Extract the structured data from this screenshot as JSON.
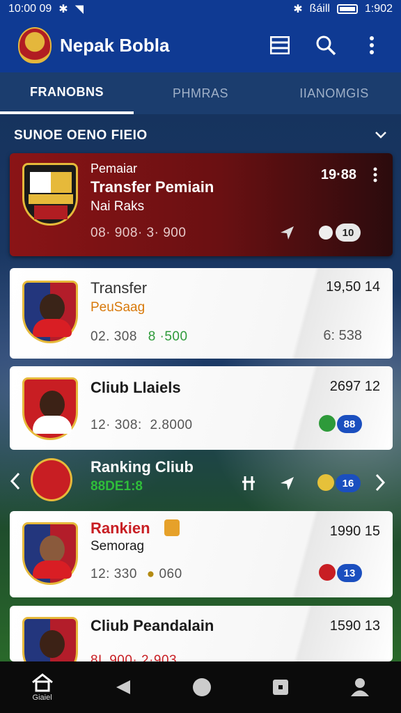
{
  "status_bar": {
    "time_left": "10:00 09",
    "time_right": "1:902",
    "signal_text": "ßáill"
  },
  "app": {
    "title": "Nepak Bobla"
  },
  "tabs": [
    {
      "label": "FRANOBNS",
      "active": true
    },
    {
      "label": "PHMRAS",
      "active": false
    },
    {
      "label": "IIANOMGIS",
      "active": false
    }
  ],
  "section": {
    "title": "SUNOE OENO FIEIO"
  },
  "cards": [
    {
      "overline": "Pemaiar",
      "title": "Transfer Pemiain",
      "sub": "Nai Raks",
      "meta": "08· 908· 3· 900",
      "right": "19·88",
      "badge": "10"
    },
    {
      "title": "Transfer",
      "sub": "PeuSaag",
      "meta_a": "02. 308",
      "meta_b": "8 ·500",
      "right": "19,50 14",
      "right_meta": "6: 538"
    },
    {
      "title": "Cliub Llaiels",
      "meta": "12· 308:",
      "meta_b": "2.8000",
      "right": "2697 12",
      "badge": "88"
    },
    {
      "title": "Rankien",
      "sub": "Semorag",
      "meta": "12: 330",
      "meta_b": "060",
      "right": "1990 15",
      "badge": "13"
    },
    {
      "title": "Cliub Peandalain",
      "right": "1590 13",
      "meta": "8L 900· 2·903"
    }
  ],
  "ranking": {
    "title": "Ranking Cliub",
    "sub": "88DE1:8",
    "badge": "16"
  },
  "navbar": {
    "home_label": "Giaiel"
  },
  "colors": {
    "app_bar": "#0f3a93",
    "tab_bar": "#1b3d6e",
    "red_card": "#8a1416",
    "badge_blue": "#1b4fbf",
    "green": "#2e9a3a",
    "ranking_sub": "#2fbd3a"
  }
}
